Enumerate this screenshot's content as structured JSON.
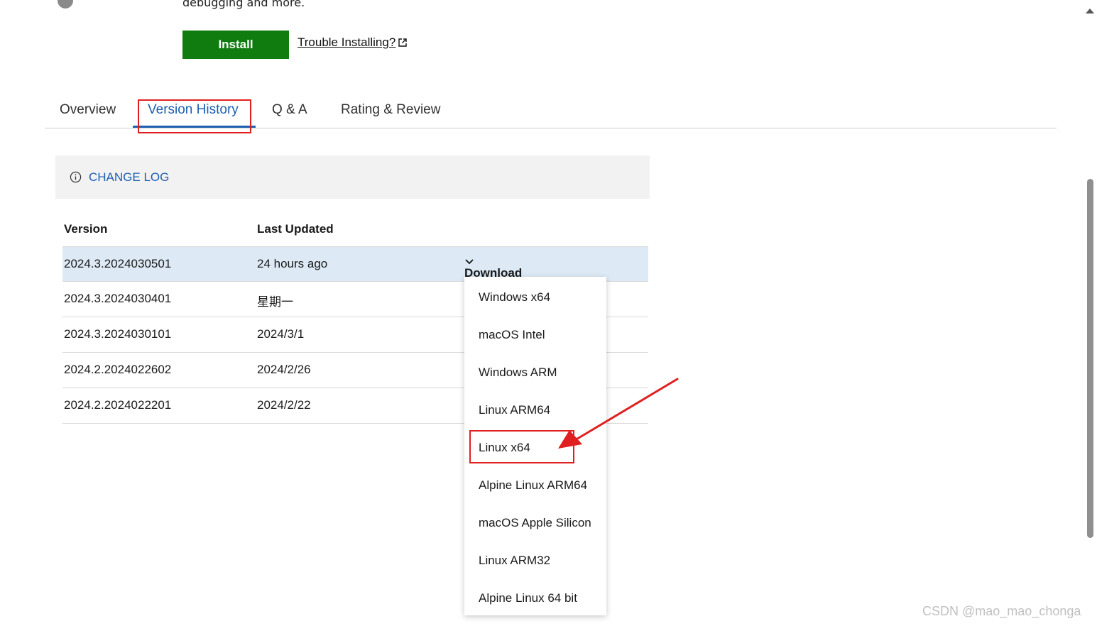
{
  "header": {
    "description_tail": "debugging and more.",
    "install_label": "Install",
    "trouble_label": "Trouble Installing?"
  },
  "tabs": [
    {
      "label": "Overview",
      "active": false
    },
    {
      "label": "Version History",
      "active": true
    },
    {
      "label": "Q & A",
      "active": false
    },
    {
      "label": "Rating & Review",
      "active": false
    }
  ],
  "changelog": {
    "label": "CHANGE LOG",
    "icon": "info-icon"
  },
  "table": {
    "headers": [
      "Version",
      "Last Updated"
    ],
    "rows": [
      {
        "version": "2024.3.2024030501",
        "updated": "24 hours ago"
      },
      {
        "version": "2024.3.2024030401",
        "updated": "星期一"
      },
      {
        "version": "2024.3.2024030101",
        "updated": "2024/3/1"
      },
      {
        "version": "2024.2.2024022602",
        "updated": "2024/2/26"
      },
      {
        "version": "2024.2.2024022201",
        "updated": "2024/2/22"
      }
    ],
    "download_label": "Download"
  },
  "download_menu": {
    "items": [
      "Windows x64",
      "macOS Intel",
      "Windows ARM",
      "Linux ARM64",
      "Linux x64",
      "Alpine Linux ARM64",
      "macOS Apple Silicon",
      "Linux ARM32",
      "Alpine Linux 64 bit"
    ],
    "highlighted": "Linux x64"
  },
  "colors": {
    "install_green": "#107c10",
    "accent_blue": "#1e60b0",
    "row_highlight": "#ddeaf6",
    "annotation_red": "#e02020"
  },
  "watermark": "CSDN @mao_mao_chonga"
}
